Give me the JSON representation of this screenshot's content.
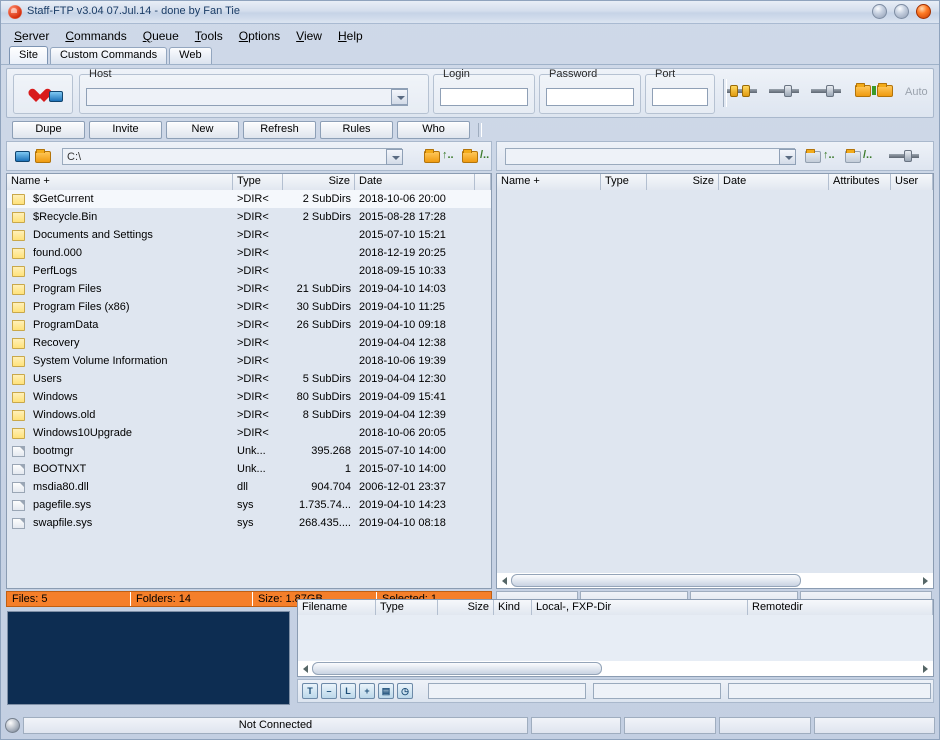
{
  "window": {
    "title": "Staff-FTP v3.04 07.Jul.14 - done by Fan Tie",
    "buttons": {
      "minimize": "",
      "maximize": "",
      "close": ""
    }
  },
  "menu": [
    "Server",
    "Commands",
    "Queue",
    "Tools",
    "Options",
    "View",
    "Help"
  ],
  "tabs": [
    {
      "label": "Site",
      "active": true
    },
    {
      "label": "Custom Commands",
      "active": false
    },
    {
      "label": "Web",
      "active": false
    }
  ],
  "connection": {
    "host_label": "Host",
    "host_value": "",
    "login_label": "Login",
    "login_value": "",
    "password_label": "Password",
    "password_value": "",
    "port_label": "Port",
    "port_value": "",
    "auto_label": "Auto"
  },
  "actions": [
    "Dupe",
    "Invite",
    "New",
    "Refresh",
    "Rules",
    "Who"
  ],
  "local_pane": {
    "path_value": "C:\\",
    "columns": [
      "Name +",
      "Type",
      "Size",
      "Date",
      ""
    ],
    "rows": [
      {
        "icon": "folder-icon",
        "name": "$GetCurrent",
        "type": ">DIR<",
        "size": "2 SubDirs",
        "date": "2018-10-06 20:00",
        "selected": true
      },
      {
        "icon": "folder-icon",
        "name": "$Recycle.Bin",
        "type": ">DIR<",
        "size": "2 SubDirs",
        "date": "2015-08-28 17:28",
        "selected": false
      },
      {
        "icon": "folder-icon",
        "name": "Documents and Settings",
        "type": ">DIR<",
        "size": "",
        "date": "2015-07-10 15:21",
        "selected": false
      },
      {
        "icon": "folder-icon",
        "name": "found.000",
        "type": ">DIR<",
        "size": "",
        "date": "2018-12-19 20:25",
        "selected": false
      },
      {
        "icon": "folder-icon",
        "name": "PerfLogs",
        "type": ">DIR<",
        "size": "",
        "date": "2018-09-15 10:33",
        "selected": false
      },
      {
        "icon": "folder-icon",
        "name": "Program Files",
        "type": ">DIR<",
        "size": "21 SubDirs",
        "date": "2019-04-10 14:03",
        "selected": false
      },
      {
        "icon": "folder-icon",
        "name": "Program Files (x86)",
        "type": ">DIR<",
        "size": "30 SubDirs",
        "date": "2019-04-10 11:25",
        "selected": false
      },
      {
        "icon": "folder-icon",
        "name": "ProgramData",
        "type": ">DIR<",
        "size": "26 SubDirs",
        "date": "2019-04-10 09:18",
        "selected": false
      },
      {
        "icon": "folder-icon",
        "name": "Recovery",
        "type": ">DIR<",
        "size": "",
        "date": "2019-04-04 12:38",
        "selected": false
      },
      {
        "icon": "folder-icon",
        "name": "System Volume Information",
        "type": ">DIR<",
        "size": "",
        "date": "2018-10-06 19:39",
        "selected": false
      },
      {
        "icon": "folder-icon",
        "name": "Users",
        "type": ">DIR<",
        "size": "5 SubDirs",
        "date": "2019-04-04 12:30",
        "selected": false
      },
      {
        "icon": "folder-icon",
        "name": "Windows",
        "type": ">DIR<",
        "size": "80 SubDirs",
        "date": "2019-04-09 15:41",
        "selected": false
      },
      {
        "icon": "folder-icon",
        "name": "Windows.old",
        "type": ">DIR<",
        "size": "8 SubDirs",
        "date": "2019-04-04 12:39",
        "selected": false
      },
      {
        "icon": "folder-icon",
        "name": "Windows10Upgrade",
        "type": ">DIR<",
        "size": "",
        "date": "2018-10-06 20:05",
        "selected": false
      },
      {
        "icon": "file-icon",
        "name": "bootmgr",
        "type": "Unk...",
        "size": "395.268",
        "date": "2015-07-10 14:00",
        "selected": false
      },
      {
        "icon": "file-icon",
        "name": "BOOTNXT",
        "type": "Unk...",
        "size": "1",
        "date": "2015-07-10 14:00",
        "selected": false
      },
      {
        "icon": "file-icon",
        "name": "msdia80.dll",
        "type": "dll",
        "size": "904.704",
        "date": "2006-12-01 23:37",
        "selected": false
      },
      {
        "icon": "file-icon",
        "name": "pagefile.sys",
        "type": "sys",
        "size": "1.735.74...",
        "date": "2019-04-10 14:23",
        "selected": false
      },
      {
        "icon": "file-icon",
        "name": "swapfile.sys",
        "type": "sys",
        "size": "268.435....",
        "date": "2019-04-10 08:18",
        "selected": false
      }
    ],
    "status": [
      {
        "label": "Files: 5"
      },
      {
        "label": "Folders: 14"
      },
      {
        "label": "Size: 1.87GB"
      },
      {
        "label": "Selected: 1"
      }
    ]
  },
  "remote_pane": {
    "path_value": "",
    "columns": [
      "Name +",
      "Type",
      "Size",
      "Date",
      "Attributes",
      "User"
    ],
    "rows": []
  },
  "queue": {
    "columns": [
      "Filename",
      "Type",
      "Size",
      "Kind",
      "Local-, FXP-Dir",
      "Remotedir"
    ],
    "rows": [],
    "toolbar_icons": [
      "text-mode-icon",
      "minus-icon",
      "list-mode-icon",
      "plus-icon",
      "save-icon",
      "clock-icon"
    ],
    "fields": [
      "",
      "",
      ""
    ]
  },
  "statusbar": {
    "connection": "Not Connected",
    "cells": [
      "",
      "",
      "",
      ""
    ]
  },
  "colors": {
    "orange_status": "#f57f2a",
    "log_background": "#0d2d52",
    "title_text": "#1a3c66"
  }
}
